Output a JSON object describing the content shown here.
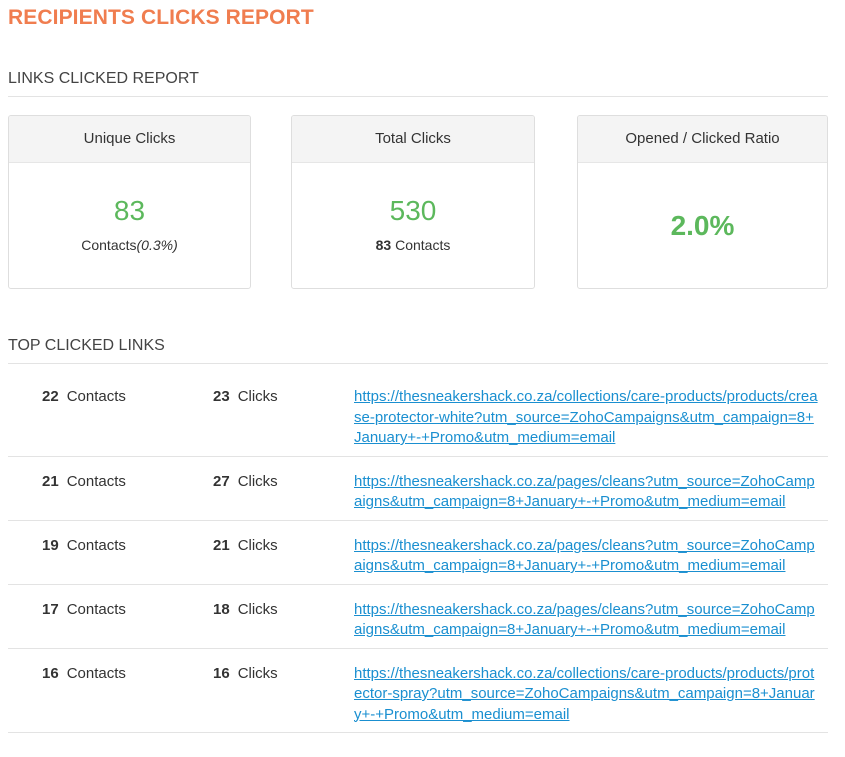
{
  "page_title": "RECIPIENTS CLICKS REPORT",
  "links_clicked_heading": "LINKS CLICKED REPORT",
  "cards": {
    "unique": {
      "label": "Unique Clicks",
      "value": "83",
      "sub_text": "Contacts",
      "sub_pct": "(0.3%)"
    },
    "total": {
      "label": "Total Clicks",
      "value": "530",
      "sub_num": "83",
      "sub_text": " Contacts"
    },
    "ratio": {
      "label": "Opened / Clicked Ratio",
      "value": "2.0%"
    }
  },
  "top_links_heading": "TOP CLICKED LINKS",
  "contacts_label": "Contacts",
  "clicks_label": "Clicks",
  "links": [
    {
      "contacts": "22",
      "clicks": "23",
      "url": "https://thesneakershack.co.za/collections/care-products/products/crease-protector-white?utm_source=ZohoCampaigns&utm_campaign=8+January+-+Promo&utm_medium=email"
    },
    {
      "contacts": "21",
      "clicks": "27",
      "url": "https://thesneakershack.co.za/pages/cleans?utm_source=ZohoCampaigns&utm_campaign=8+January+-+Promo&utm_medium=email"
    },
    {
      "contacts": "19",
      "clicks": "21",
      "url": "https://thesneakershack.co.za/pages/cleans?utm_source=ZohoCampaigns&utm_campaign=8+January+-+Promo&utm_medium=email"
    },
    {
      "contacts": "17",
      "clicks": "18",
      "url": "https://thesneakershack.co.za/pages/cleans?utm_source=ZohoCampaigns&utm_campaign=8+January+-+Promo&utm_medium=email"
    },
    {
      "contacts": "16",
      "clicks": "16",
      "url": "https://thesneakershack.co.za/collections/care-products/products/protector-spray?utm_source=ZohoCampaigns&utm_campaign=8+January+-+Promo&utm_medium=email"
    }
  ],
  "colors": {
    "title": "#f07d4f",
    "metric": "#5cb85c",
    "link": "#1a8fd0"
  }
}
